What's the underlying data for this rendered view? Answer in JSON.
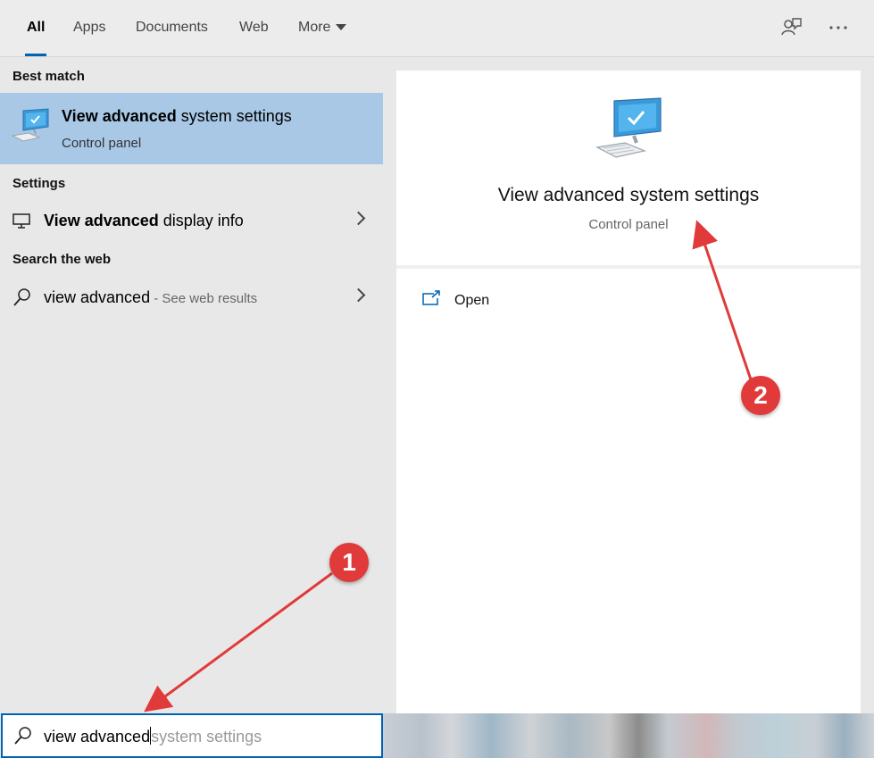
{
  "tabs": [
    {
      "label": "All",
      "active": true
    },
    {
      "label": "Apps"
    },
    {
      "label": "Documents"
    },
    {
      "label": "Web"
    },
    {
      "label": "More"
    }
  ],
  "top_icons": [
    "feedback-icon",
    "more-options-icon"
  ],
  "sections": {
    "best_match": "Best match",
    "settings": "Settings",
    "search_web": "Search the web"
  },
  "best_match": {
    "title_bold": "View advanced",
    "title_rest": " system settings",
    "subtitle": "Control panel",
    "icon": "computer-monitor-icon"
  },
  "settings_item": {
    "bold": "View advanced",
    "rest": " display info",
    "icon": "monitor-icon"
  },
  "web_item": {
    "text": "view advanced",
    "suffix": " - See web results",
    "icon": "search-icon"
  },
  "detail": {
    "title": "View advanced system settings",
    "subtitle": "Control panel",
    "open_label": "Open"
  },
  "search": {
    "typed": "view advanced",
    "suggestion": "system settings"
  },
  "annotations": [
    "1",
    "2"
  ],
  "colors": {
    "accent": "#0063b1",
    "selected_bg": "#a8c8e6",
    "annotation_red": "#e03a3a"
  }
}
